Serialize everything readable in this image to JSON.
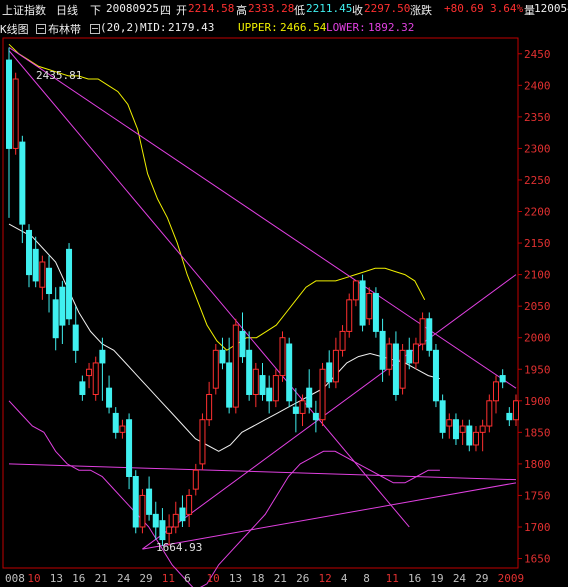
{
  "header": {
    "title": "上证指数",
    "period": "日线",
    "mode": "下",
    "date": "20080925",
    "weekday": "四",
    "open_label": "开",
    "open": "2214.58",
    "high_label": "高",
    "high": "2333.28",
    "low_label": "低",
    "low": "2211.45",
    "close_label": "收",
    "close": "2297.50",
    "change_label": "涨跌",
    "change": "+80.69",
    "change_pct": "3.64%",
    "volume_label": "量",
    "volume": "120054"
  },
  "indicator": {
    "kline_label": "K线图",
    "name": "布林带",
    "params": "(20,2)",
    "mid_label": "MID:",
    "mid": "2179.43",
    "upper_label": "UPPER:",
    "upper": "2466.54",
    "lower_label": "LOWER:",
    "lower": "1892.32"
  },
  "annotations": {
    "high_marker": "2435.81",
    "low_marker": "1664.93"
  },
  "colors": {
    "up": "#ff3030",
    "down": "#40f0f0",
    "mid": "#f0f0f0",
    "upper": "#f0f000",
    "lower": "#e040e0",
    "trend": "#e040e0",
    "axis": "#c00000"
  },
  "chart_data": {
    "type": "candlestick",
    "ylim": [
      1635,
      2475
    ],
    "y_ticks": [
      1650,
      1700,
      1750,
      1800,
      1850,
      1900,
      1950,
      2000,
      2050,
      2100,
      2150,
      2200,
      2250,
      2300,
      2350,
      2400,
      2450
    ],
    "x_tick_labels": [
      "008",
      "10",
      "13",
      "16",
      "21",
      "24",
      "29",
      "11",
      "6",
      "10",
      "13",
      "18",
      "21",
      "26",
      "12",
      "4",
      "8",
      "11",
      "16",
      "19",
      "24",
      "29",
      "2009"
    ],
    "x_tick_red": [
      "10",
      "11",
      "12",
      "2009"
    ],
    "candles": [
      [
        2440,
        2460,
        2190,
        2300
      ],
      [
        2300,
        2420,
        2290,
        2410
      ],
      [
        2310,
        2320,
        2150,
        2180
      ],
      [
        2170,
        2180,
        2080,
        2100
      ],
      [
        2140,
        2160,
        2080,
        2090
      ],
      [
        2080,
        2130,
        2060,
        2120
      ],
      [
        2110,
        2130,
        2040,
        2070
      ],
      [
        2060,
        2080,
        1980,
        2000
      ],
      [
        2080,
        2090,
        1990,
        2020
      ],
      [
        2140,
        2150,
        2020,
        2030
      ],
      [
        2020,
        2050,
        1960,
        1980
      ],
      [
        1930,
        1940,
        1900,
        1910
      ],
      [
        1940,
        1960,
        1920,
        1950
      ],
      [
        1910,
        1970,
        1900,
        1960
      ],
      [
        1980,
        2000,
        1900,
        1960
      ],
      [
        1920,
        1940,
        1880,
        1890
      ],
      [
        1880,
        1890,
        1840,
        1850
      ],
      [
        1850,
        1870,
        1840,
        1860
      ],
      [
        1870,
        1880,
        1760,
        1780
      ],
      [
        1780,
        1790,
        1690,
        1700
      ],
      [
        1700,
        1760,
        1690,
        1750
      ],
      [
        1760,
        1780,
        1710,
        1720
      ],
      [
        1720,
        1740,
        1680,
        1700
      ],
      [
        1710,
        1730,
        1670,
        1680
      ],
      [
        1690,
        1720,
        1670,
        1700
      ],
      [
        1700,
        1740,
        1690,
        1720
      ],
      [
        1730,
        1750,
        1700,
        1710
      ],
      [
        1720,
        1760,
        1700,
        1750
      ],
      [
        1760,
        1800,
        1750,
        1790
      ],
      [
        1800,
        1880,
        1790,
        1870
      ],
      [
        1870,
        1930,
        1860,
        1910
      ],
      [
        1920,
        1990,
        1910,
        1980
      ],
      [
        1980,
        2000,
        1950,
        1960
      ],
      [
        1960,
        2000,
        1880,
        1890
      ],
      [
        1890,
        2030,
        1880,
        2020
      ],
      [
        2010,
        2040,
        1960,
        1970
      ],
      [
        1980,
        2010,
        1900,
        1910
      ],
      [
        1910,
        1960,
        1890,
        1950
      ],
      [
        1940,
        1960,
        1900,
        1910
      ],
      [
        1920,
        1940,
        1880,
        1900
      ],
      [
        1900,
        1950,
        1890,
        1940
      ],
      [
        1940,
        2010,
        1930,
        2000
      ],
      [
        1990,
        2000,
        1890,
        1900
      ],
      [
        1890,
        1920,
        1850,
        1880
      ],
      [
        1880,
        1910,
        1860,
        1900
      ],
      [
        1920,
        1950,
        1880,
        1890
      ],
      [
        1880,
        1900,
        1850,
        1870
      ],
      [
        1870,
        1960,
        1860,
        1950
      ],
      [
        1960,
        1980,
        1920,
        1930
      ],
      [
        1930,
        2000,
        1920,
        1980
      ],
      [
        1980,
        2020,
        1970,
        2010
      ],
      [
        2010,
        2070,
        2000,
        2060
      ],
      [
        2060,
        2090,
        2050,
        2090
      ],
      [
        2090,
        2100,
        2010,
        2020
      ],
      [
        2030,
        2080,
        2020,
        2070
      ],
      [
        2070,
        2080,
        2000,
        2010
      ],
      [
        2010,
        2030,
        1930,
        1950
      ],
      [
        1950,
        2000,
        1940,
        1990
      ],
      [
        1990,
        2010,
        1900,
        1910
      ],
      [
        1920,
        1990,
        1910,
        1980
      ],
      [
        1980,
        2000,
        1950,
        1960
      ],
      [
        1960,
        2000,
        1950,
        1990
      ],
      [
        1990,
        2040,
        1980,
        2030
      ],
      [
        2030,
        2040,
        1970,
        1980
      ],
      [
        1980,
        1990,
        1890,
        1900
      ],
      [
        1900,
        1910,
        1840,
        1850
      ],
      [
        1860,
        1880,
        1840,
        1870
      ],
      [
        1870,
        1880,
        1830,
        1840
      ],
      [
        1850,
        1870,
        1830,
        1860
      ],
      [
        1860,
        1870,
        1820,
        1830
      ],
      [
        1830,
        1860,
        1820,
        1850
      ],
      [
        1850,
        1870,
        1820,
        1860
      ],
      [
        1860,
        1910,
        1850,
        1900
      ],
      [
        1900,
        1940,
        1880,
        1930
      ],
      [
        1940,
        1950,
        1920,
        1930
      ],
      [
        1880,
        1890,
        1860,
        1870
      ],
      [
        1870,
        1910,
        1860,
        1900
      ]
    ],
    "upper_band": [
      2465,
      2450,
      2440,
      2430,
      2425,
      2420,
      2415,
      2415,
      2410,
      2410,
      2400,
      2390,
      2370,
      2330,
      2260,
      2220,
      2190,
      2150,
      2100,
      2060,
      2020,
      1995,
      1980,
      1990,
      2000,
      2000,
      2010,
      2020,
      2040,
      2060,
      2080,
      2090,
      2090,
      2090,
      2095,
      2100,
      2105,
      2110,
      2110,
      2105,
      2100,
      2090,
      2060
    ],
    "mid_band": [
      2180,
      2170,
      2160,
      2140,
      2120,
      2080,
      2040,
      2010,
      1990,
      1980,
      1960,
      1940,
      1920,
      1900,
      1880,
      1860,
      1840,
      1830,
      1820,
      1830,
      1850,
      1860,
      1870,
      1880,
      1890,
      1900,
      1910,
      1920,
      1940,
      1960,
      1970,
      1975,
      1970,
      1965,
      1960,
      1950,
      1940,
      1935
    ],
    "lower_band": [
      1900,
      1880,
      1860,
      1850,
      1820,
      1800,
      1790,
      1790,
      1780,
      1760,
      1740,
      1720,
      1700,
      1670,
      1640,
      1620,
      1600,
      1610,
      1640,
      1660,
      1680,
      1700,
      1720,
      1750,
      1780,
      1800,
      1810,
      1820,
      1820,
      1810,
      1800,
      1790,
      1780,
      1770,
      1770,
      1780,
      1790,
      1790
    ],
    "trend_lines": [
      {
        "from": [
          0,
          2460
        ],
        "to": [
          76,
          1920
        ]
      },
      {
        "from": [
          0,
          2455
        ],
        "to": [
          60,
          1700
        ]
      },
      {
        "from": [
          20,
          1665
        ],
        "to": [
          76,
          1770
        ]
      },
      {
        "from": [
          0,
          1800
        ],
        "to": [
          76,
          1775
        ]
      },
      {
        "from": [
          20,
          1665
        ],
        "to": [
          76,
          2100
        ]
      }
    ]
  }
}
